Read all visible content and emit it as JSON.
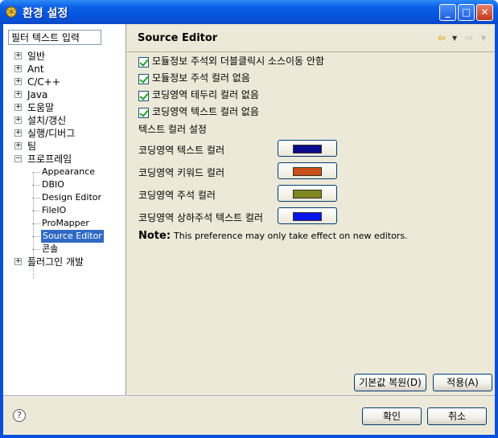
{
  "window": {
    "title": "환경 설정"
  },
  "filter": {
    "placeholder": "필터 텍스트 입력",
    "value": "필터 텍스트 입력"
  },
  "tree": {
    "top_items": [
      {
        "label": "일반"
      },
      {
        "label": "Ant"
      },
      {
        "label": "C/C++"
      },
      {
        "label": "Java"
      },
      {
        "label": "도움말"
      },
      {
        "label": "설치/갱신"
      },
      {
        "label": "실행/디버그"
      },
      {
        "label": "팀"
      },
      {
        "label": "프로프레임"
      }
    ],
    "children": [
      {
        "label": "Appearance"
      },
      {
        "label": "DBIO"
      },
      {
        "label": "Design Editor"
      },
      {
        "label": "FileIO"
      },
      {
        "label": "ProMapper"
      },
      {
        "label": "Source Editor"
      },
      {
        "label": "콘솔"
      }
    ],
    "last_item": {
      "label": "플러그인 개발"
    }
  },
  "page": {
    "title": "Source Editor",
    "checkboxes": [
      {
        "label": "모듈정보 주석외 더블클릭시 소스이동 안함",
        "checked": true
      },
      {
        "label": "모듈정보 주석 컬러 없음",
        "checked": true
      },
      {
        "label": "코딩영역  테두리 컬러 없음",
        "checked": true
      },
      {
        "label": "코딩영역 텍스트 컬러 없음",
        "checked": true
      }
    ],
    "section_label": "텍스트 컬러 설정",
    "colors": [
      {
        "label": "코딩영역 텍스트 컬러",
        "color": "#0a0a8c"
      },
      {
        "label": "코딩영역 키워드 컬러",
        "color": "#c8501a"
      },
      {
        "label": "코딩영역 주석 컬러",
        "color": "#80861e"
      },
      {
        "label": "코딩영역 상하주석 텍스트 컬러",
        "color": "#0a14f0"
      }
    ],
    "note_bold": "Note:",
    "note_text": "This preference may only take effect on new editors.",
    "restore_defaults": "기본값 복원(D)",
    "apply": "적용(A)"
  },
  "footer": {
    "help_icon": "help-icon",
    "ok": "확인",
    "cancel": "취소"
  }
}
